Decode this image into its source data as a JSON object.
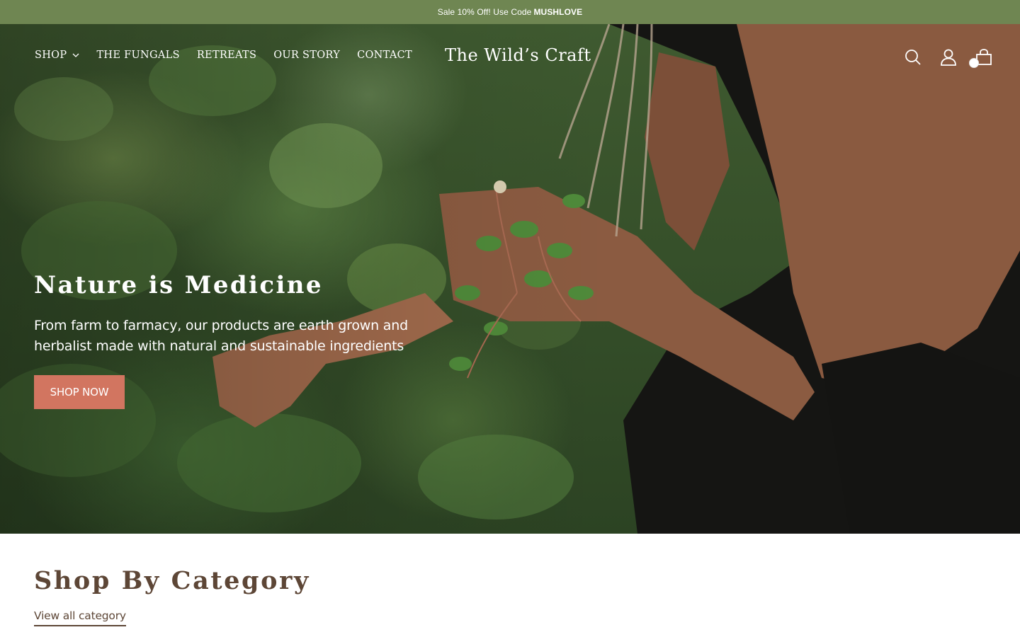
{
  "announcement": {
    "text": "Sale 10% Off! Use Code",
    "code": "MUSHLOVE"
  },
  "header": {
    "nav": [
      {
        "label": "SHOP",
        "has_dropdown": true
      },
      {
        "label": "THE FUNGALS"
      },
      {
        "label": "RETREATS"
      },
      {
        "label": "OUR STORY"
      },
      {
        "label": "CONTACT"
      }
    ],
    "logo": "The Wild’s Craft",
    "icons": [
      "search-icon",
      "account-icon",
      "cart-icon"
    ]
  },
  "hero": {
    "title": "Nature is Medicine",
    "subtitle": "From farm to farmacy, our products are earth grown and herbalist made with natural and sustainable ingredients",
    "cta_label": "SHOP NOW"
  },
  "category": {
    "title": "Shop By Category",
    "link_label": "View all category"
  },
  "colors": {
    "announcement_bg": "#6f8652",
    "cta_bg": "#d27560",
    "heading": "#5d4636"
  }
}
